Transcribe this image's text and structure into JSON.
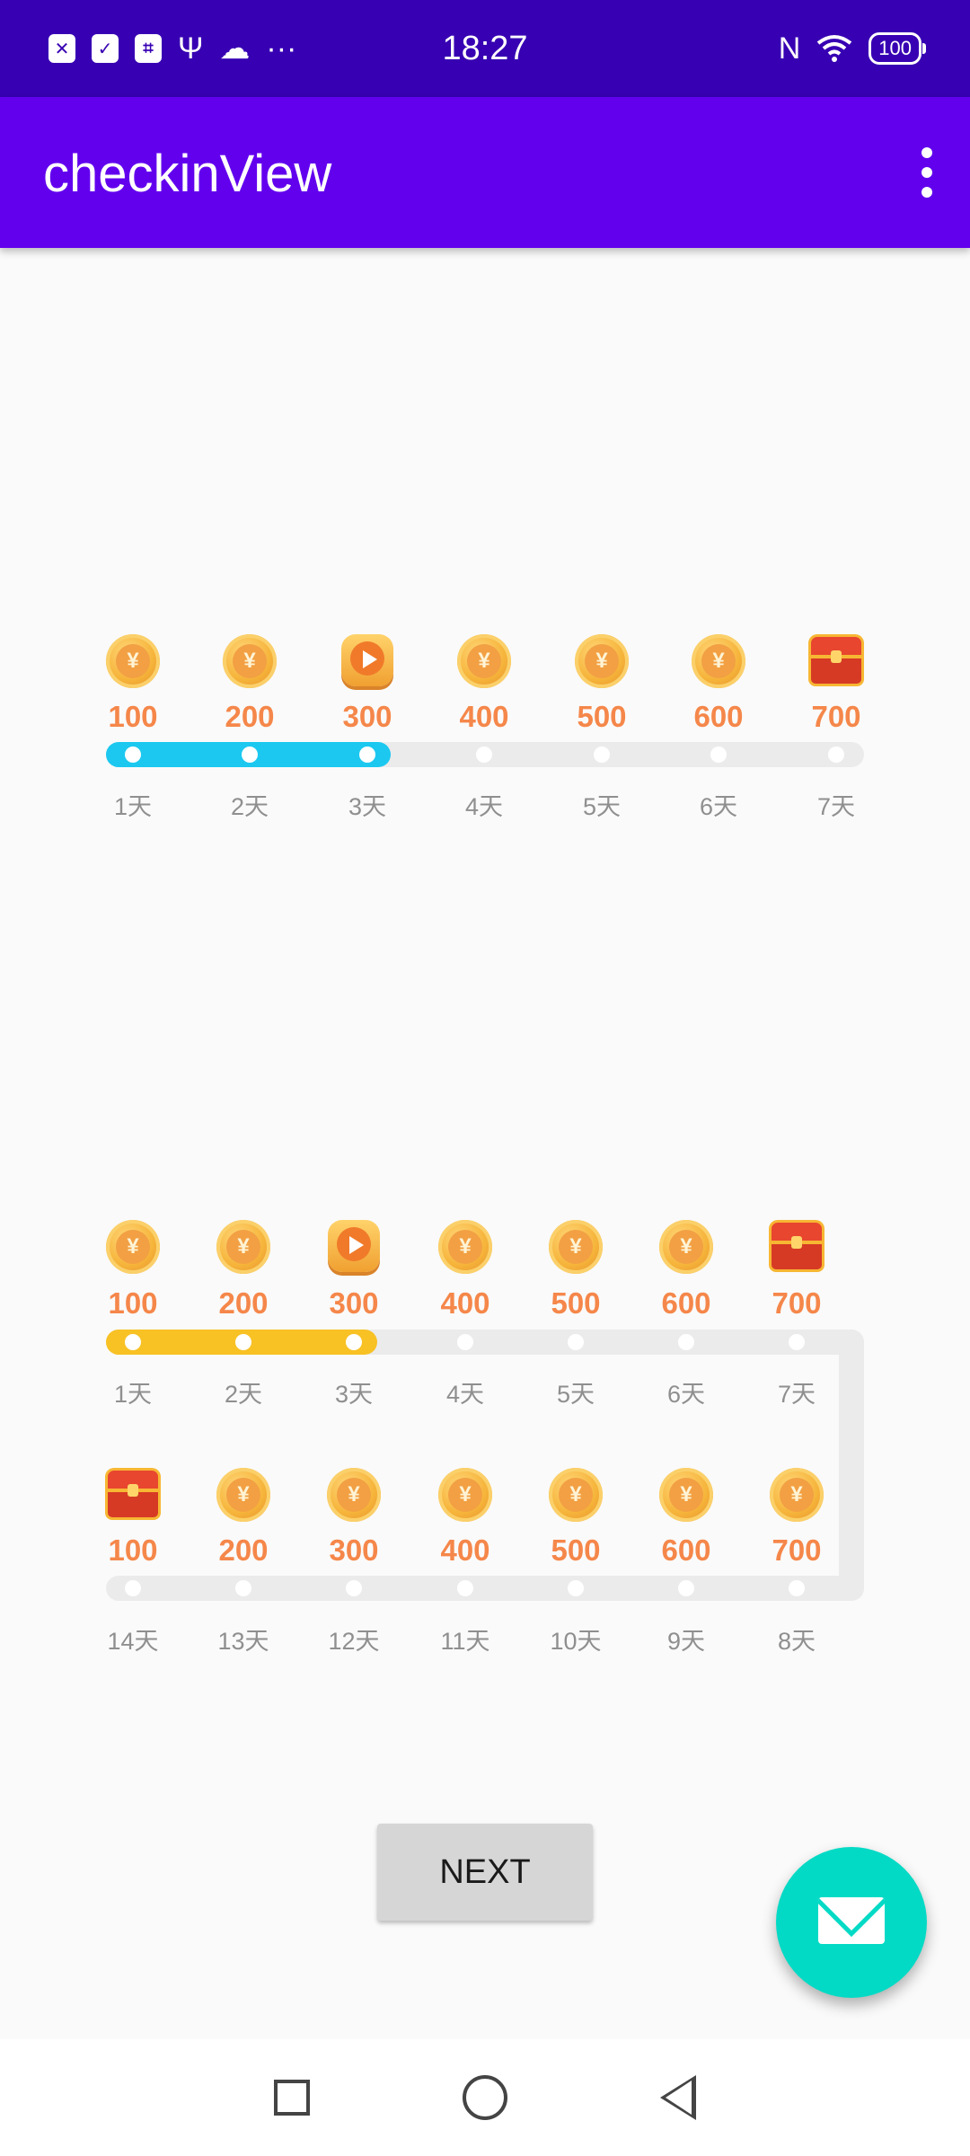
{
  "status_bar": {
    "time": "18:27",
    "battery": "100",
    "left_icons": [
      "sim-x-icon",
      "check-box-icon",
      "usb-debug-icon",
      "usb-icon",
      "cloud-icon",
      "more-dots-icon"
    ],
    "right_icons": [
      "nfc-icon",
      "wifi-icon",
      "battery-icon"
    ]
  },
  "app_bar": {
    "title": "checkinView",
    "menu_icon": "overflow-menu-icon"
  },
  "checkin_row": {
    "rewards": [
      "100",
      "200",
      "300",
      "400",
      "500",
      "600",
      "700"
    ],
    "days": [
      "1天",
      "2天",
      "3天",
      "4天",
      "5天",
      "6天",
      "7天"
    ],
    "icons": [
      "coin-icon",
      "coin-icon",
      "video-play-icon",
      "coin-icon",
      "coin-icon",
      "coin-icon",
      "treasure-chest-icon"
    ],
    "completed_days": 3,
    "total_days": 7,
    "progress_color": "#1cc8f0",
    "track_color": "#ebebeb"
  },
  "checkin_snake": {
    "row1_rewards": [
      "100",
      "200",
      "300",
      "400",
      "500",
      "600",
      "700"
    ],
    "row1_days": [
      "1天",
      "2天",
      "3天",
      "4天",
      "5天",
      "6天",
      "7天"
    ],
    "row1_icons": [
      "coin-icon",
      "coin-icon",
      "video-play-icon",
      "coin-icon",
      "coin-icon",
      "coin-icon",
      "treasure-chest-icon"
    ],
    "row2_rewards": [
      "100",
      "200",
      "300",
      "400",
      "500",
      "600",
      "700"
    ],
    "row2_days": [
      "14天",
      "13天",
      "12天",
      "11天",
      "10天",
      "9天",
      "8天"
    ],
    "row2_icons": [
      "treasure-chest-icon",
      "coin-icon",
      "coin-icon",
      "coin-icon",
      "coin-icon",
      "coin-icon",
      "coin-icon"
    ],
    "completed_days": 3,
    "total_days": 14,
    "progress_color": "#f8c124",
    "track_color": "#ebebeb"
  },
  "next_button": {
    "label": "NEXT"
  },
  "fab": {
    "icon": "email-icon",
    "color": "#03dac5"
  },
  "nav_bar": {
    "icons": [
      "recents-square-icon",
      "home-circle-icon",
      "back-triangle-icon"
    ]
  }
}
